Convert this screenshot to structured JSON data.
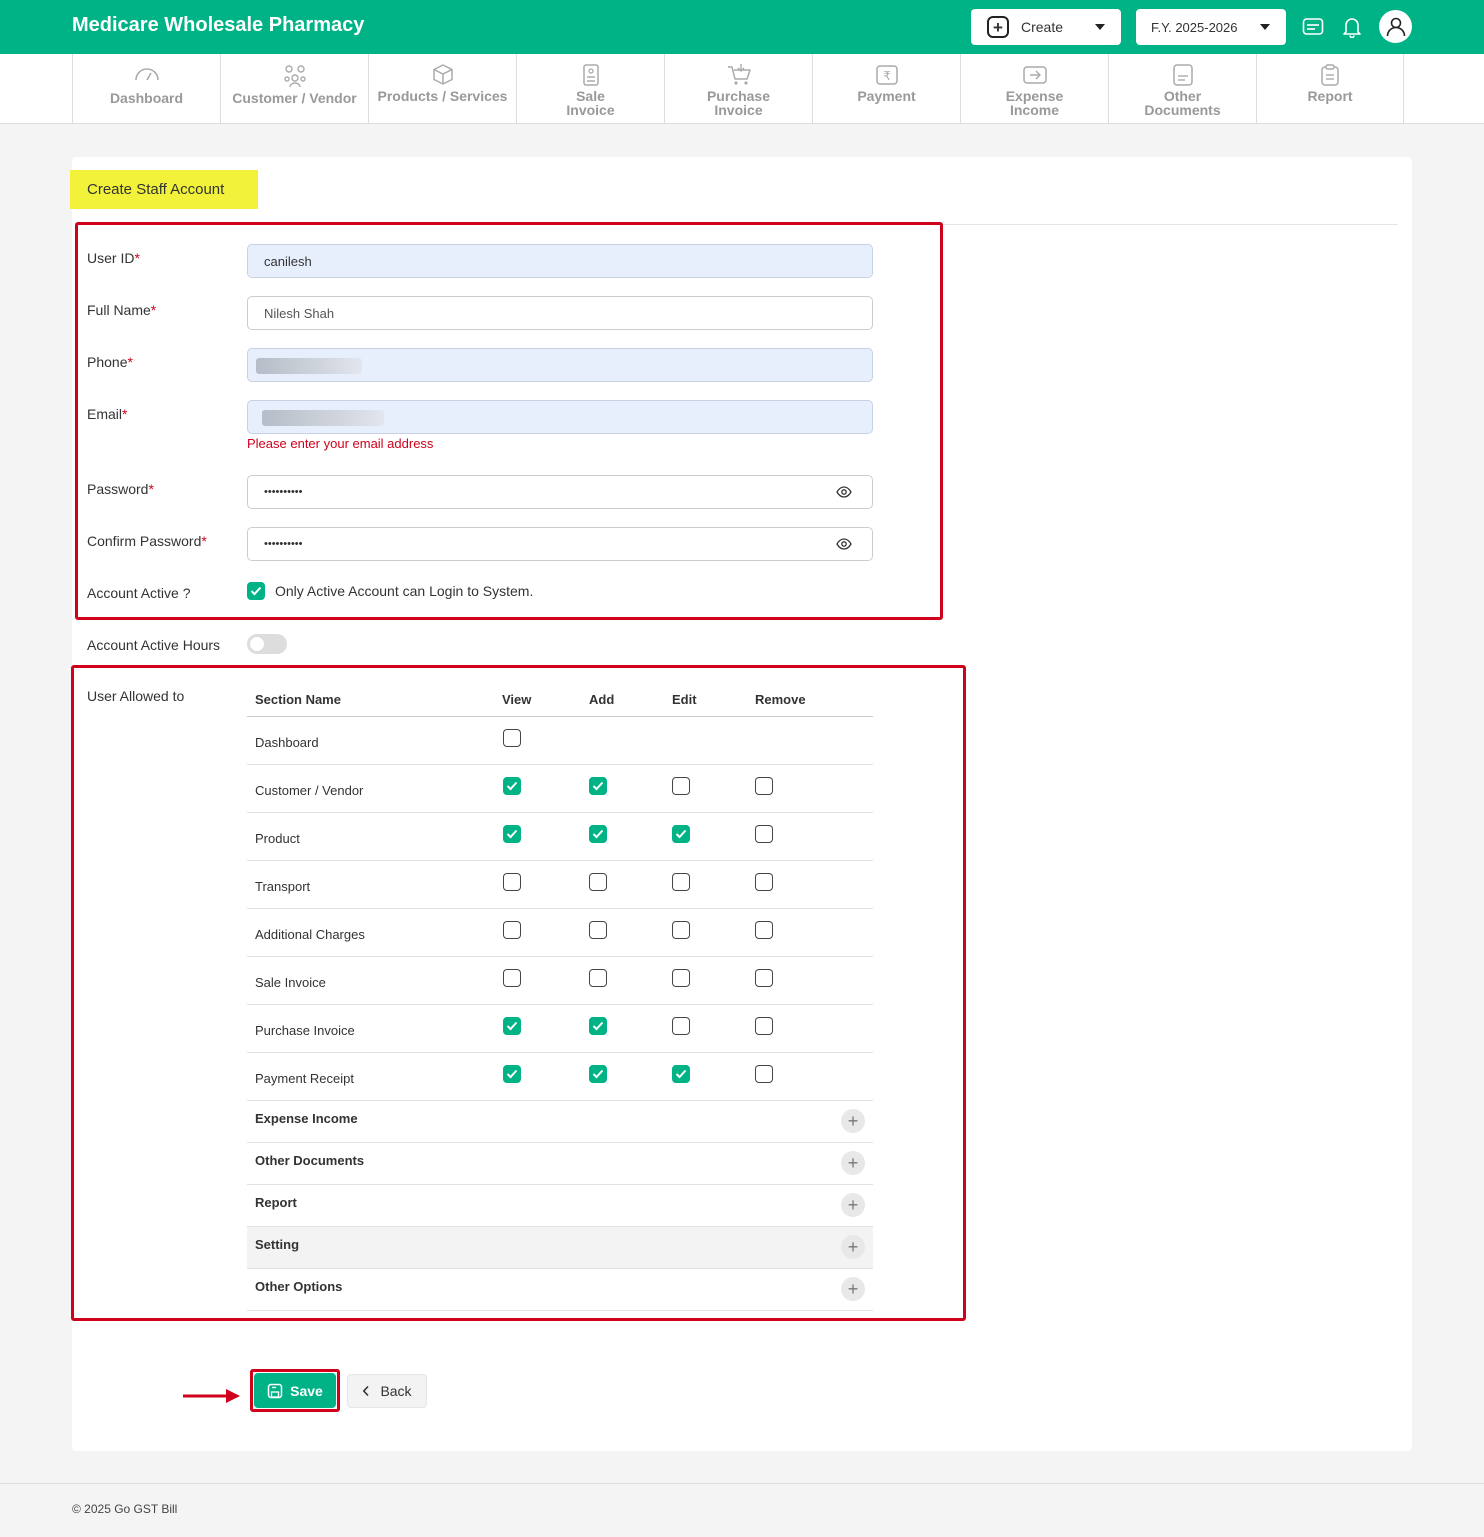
{
  "app": {
    "title": "Medicare Wholesale Pharmacy",
    "create_label": "Create",
    "fy_label": "F.Y. 2025-2026"
  },
  "nav": [
    {
      "label": "Dashboard",
      "icon": "gauge-icon"
    },
    {
      "label": "Customer / Vendor",
      "icon": "users-icon"
    },
    {
      "label": "Products / Services",
      "icon": "box-icon"
    },
    {
      "label": "Sale\nInvoice",
      "icon": "sale-invoice-icon"
    },
    {
      "label": "Purchase\nInvoice",
      "icon": "cart-icon"
    },
    {
      "label": "Payment",
      "icon": "rupee-icon"
    },
    {
      "label": "Expense\nIncome",
      "icon": "expense-icon"
    },
    {
      "label": "Other\nDocuments",
      "icon": "document-icon"
    },
    {
      "label": "Report",
      "icon": "clipboard-icon"
    }
  ],
  "page": {
    "title": "Create Staff Account"
  },
  "form": {
    "user_id_label": "User ID",
    "user_id_value": "canilesh",
    "full_name_label": "Full Name",
    "full_name_value": "Nilesh Shah",
    "phone_label": "Phone",
    "email_label": "Email",
    "email_error": "Please enter your email address",
    "password_label": "Password",
    "password_value": "••••••••••",
    "confirm_password_label": "Confirm Password",
    "confirm_password_value": "••••••••••",
    "account_active_label": "Account Active ?",
    "account_active_text": "Only Active Account can Login to System.",
    "account_active_checked": true,
    "active_hours_label": "Account Active Hours",
    "active_hours_on": false,
    "required_mark": "*"
  },
  "permissions": {
    "label": "User Allowed to",
    "headers": {
      "section": "Section Name",
      "view": "View",
      "add": "Add",
      "edit": "Edit",
      "remove": "Remove"
    },
    "rows": [
      {
        "name": "Dashboard",
        "view": false,
        "add": null,
        "edit": null,
        "remove": null
      },
      {
        "name": "Customer / Vendor",
        "view": true,
        "add": true,
        "edit": false,
        "remove": false
      },
      {
        "name": "Product",
        "view": true,
        "add": true,
        "edit": true,
        "remove": false
      },
      {
        "name": "Transport",
        "view": false,
        "add": false,
        "edit": false,
        "remove": false
      },
      {
        "name": "Additional Charges",
        "view": false,
        "add": false,
        "edit": false,
        "remove": false
      },
      {
        "name": "Sale Invoice",
        "view": false,
        "add": false,
        "edit": false,
        "remove": false
      },
      {
        "name": "Purchase Invoice",
        "view": true,
        "add": true,
        "edit": false,
        "remove": false
      },
      {
        "name": "Payment Receipt",
        "view": true,
        "add": true,
        "edit": true,
        "remove": false
      }
    ],
    "groups": [
      {
        "name": "Expense Income"
      },
      {
        "name": "Other Documents"
      },
      {
        "name": "Report"
      },
      {
        "name": "Setting"
      },
      {
        "name": "Other Options"
      }
    ]
  },
  "buttons": {
    "save": "Save",
    "back": "Back"
  },
  "footer": {
    "text": "© 2025 Go GST Bill"
  },
  "colors": {
    "brand": "#00b386",
    "highlight": "#f2f23a",
    "annotation": "#d0021b"
  }
}
